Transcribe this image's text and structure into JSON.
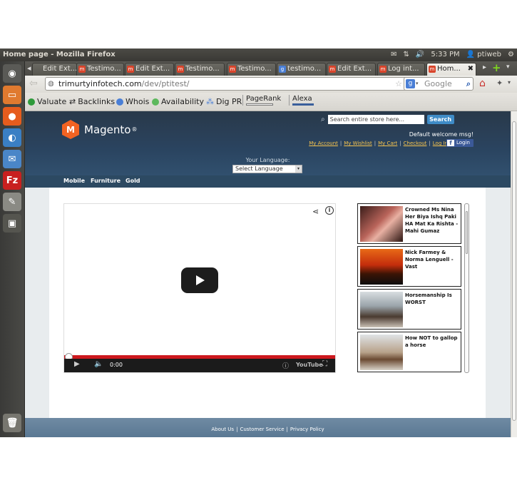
{
  "panel": {
    "window_title": "Home page - Mozilla Firefox",
    "time": "5:33 PM",
    "user": "ptiweb"
  },
  "tabs": [
    {
      "label": "Edit Ext...",
      "icon": "magento-favicon-icon"
    },
    {
      "label": "Testimo...",
      "icon": "magento-favicon-icon"
    },
    {
      "label": "Edit Ext...",
      "icon": "magento-favicon-icon"
    },
    {
      "label": "Testimo...",
      "icon": "magento-favicon-icon"
    },
    {
      "label": "Testimo...",
      "icon": "magento-favicon-icon"
    },
    {
      "label": "testimo...",
      "icon": "google-favicon-icon"
    },
    {
      "label": "Edit Ext...",
      "icon": "magento-favicon-icon"
    },
    {
      "label": "Log int...",
      "icon": "magento-favicon-icon"
    },
    {
      "label": "Hom...",
      "icon": "magento-favicon-icon",
      "active": true
    }
  ],
  "navbar": {
    "url_host": "trimurtyinfotech.com",
    "url_path": "/dev/ptitest/",
    "search_placeholder": "Google"
  },
  "toolbar": {
    "valuate": "Valuate",
    "backlinks": "Backlinks",
    "whois": "Whois",
    "availability": "Availability",
    "dig_pr": "Dig PR",
    "pagerank": "PageRank",
    "alexa": "Alexa"
  },
  "store": {
    "logo_text": "Magento",
    "logo_mark": "®",
    "search_placeholder": "Search entire store here...",
    "search_button": "Search",
    "welcome": "Default welcome msg!",
    "header_links": [
      "My Account",
      "My Wishlist",
      "My Cart",
      "Checkout",
      "Log In"
    ],
    "fb_login": "Login",
    "language_label": "Your Language:",
    "language_select": "Select Language",
    "categories": [
      "Mobile",
      "Furniture",
      "Gold"
    ],
    "footer_links": [
      "About Us",
      "Customer Service",
      "Privacy Policy"
    ]
  },
  "player": {
    "time": "0:00",
    "brand": "YouTube",
    "progress_fraction": 0.0
  },
  "related": [
    {
      "title": "Crowned Ms Nina Her Biya Ishq Paki HA Mat Ka Rishta - Mahi Gumaz"
    },
    {
      "title": "Nick Farmey & Norma Lenguell - Vast"
    },
    {
      "title": "Horsemanship Is WORST"
    },
    {
      "title": "How NOT to gallop a horse"
    }
  ],
  "colors": {
    "magento_orange": "#f26322",
    "header_blue": "#2a4460",
    "youtube_red": "#cc181e",
    "link_yellow": "#f6c44f"
  }
}
